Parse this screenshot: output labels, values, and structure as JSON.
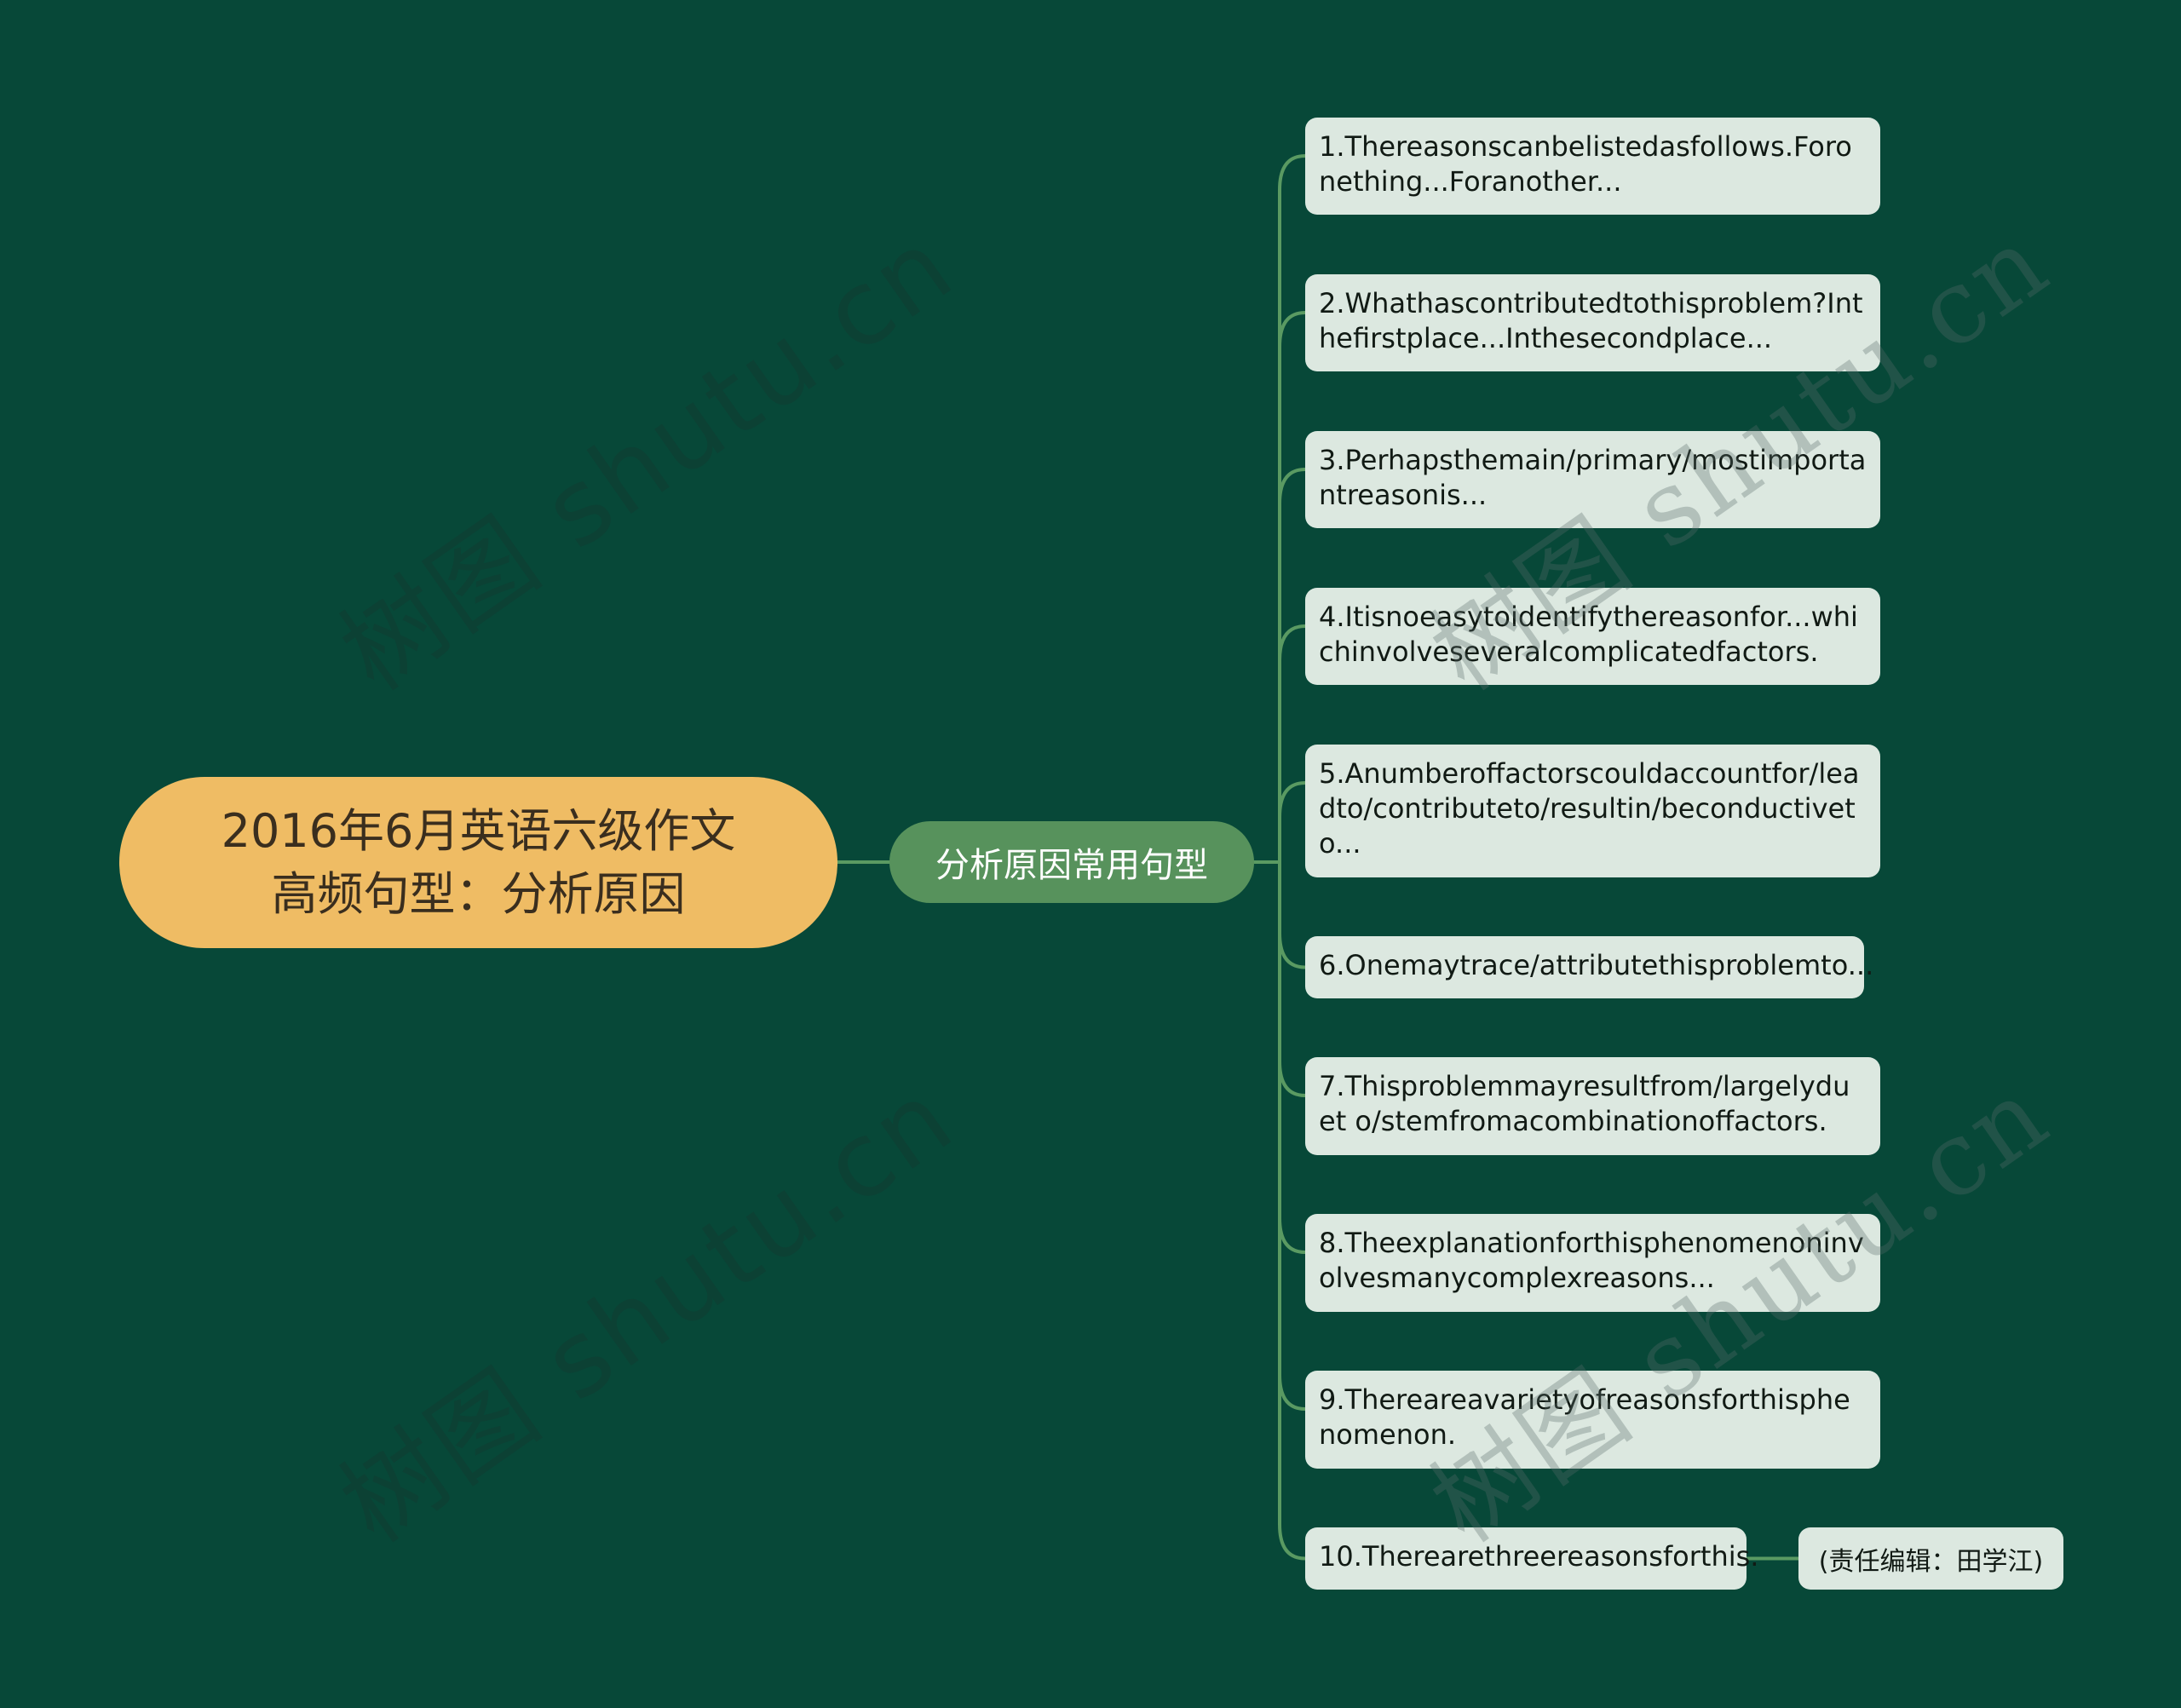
{
  "colors": {
    "background": "#074838",
    "root_fill": "#EFBC64",
    "root_text": "#3a2e1e",
    "branch_fill": "#57925C",
    "branch_text": "#ffffff",
    "leaf_fill": "#DCE8E0",
    "leaf_text": "#111a14",
    "connector": "#5A9A62"
  },
  "root": {
    "line1": "2016年6月英语六级作文",
    "line2": "高频句型：分析原因"
  },
  "branch": {
    "label": "分析原因常用句型"
  },
  "leaves": [
    {
      "text": "1.Thereasonscanbelistedasfollows.Foronething...Foranother..."
    },
    {
      "text": "2.Whathascontributedtothisproblem?Inthefirstplace...Inthesecondplace..."
    },
    {
      "text": "3.Perhapsthemain/primary/mostimportantreasonis..."
    },
    {
      "text": "4.Itisnoeasytoidentifythereasonfor...whichinvolveseveralcomplicatedfactors."
    },
    {
      "text": "5.Anumberoffactorscouldaccountfor/leadto/contributeto/resultin/beconductiveto..."
    },
    {
      "text": "6.Onemaytrace/attributethisproblemto..."
    },
    {
      "text": "7.Thisproblemmayresultfrom/largelyduet o/stemfromacombinationoffactors."
    },
    {
      "text": "8.Theexplanationforthisphenomenoninvolvesmanycomplexreasons..."
    },
    {
      "text": "9.Thereareavarietyofreasonsforthisphenomenon."
    },
    {
      "text": "10.Therearethreereasonsforthis."
    }
  ],
  "remark": {
    "text": "(责任编辑：田学江)"
  },
  "watermark": {
    "text": "树图 shutu.cn"
  }
}
